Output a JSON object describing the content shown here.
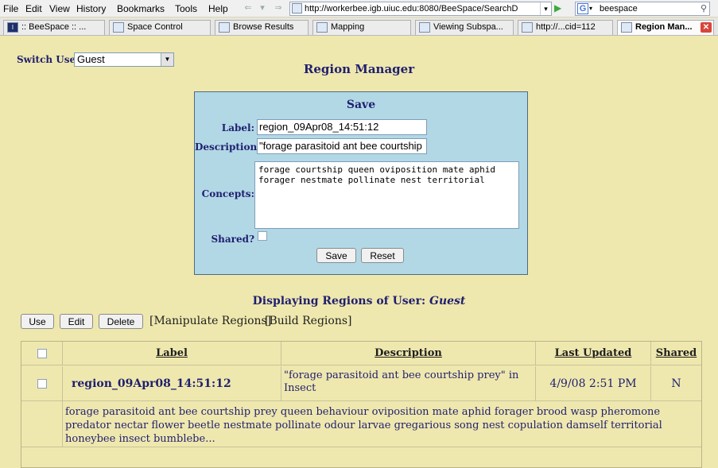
{
  "browser": {
    "menu": [
      "File",
      "Edit",
      "View",
      "History",
      "Bookmarks",
      "Tools",
      "Help"
    ],
    "url": "http://workerbee.igb.uiuc.edu:8080/BeeSpace/SearchD",
    "search_value": "beespace",
    "tabs": [
      {
        "label": ":: BeeSpace :: ..."
      },
      {
        "label": "Space Control"
      },
      {
        "label": "Browse Results"
      },
      {
        "label": "Mapping"
      },
      {
        "label": "Viewing Subspa..."
      },
      {
        "label": "http://...cid=112"
      },
      {
        "label": "Region Man..."
      }
    ]
  },
  "page": {
    "switch_user_label": "Switch User:",
    "user_selected": "Guest",
    "title": "Region Manager",
    "save": {
      "title": "Save",
      "label_label": "Label:",
      "label_value": "region_09Apr08_14:51:12",
      "description_label": "Description:",
      "description_value": "\"forage parasitoid ant bee courtship",
      "concepts_label": "Concepts:",
      "concepts_value": "forage courtship queen oviposition mate aphid forager nestmate pollinate nest territorial",
      "shared_label": "Shared?",
      "save_button": "Save",
      "reset_button": "Reset"
    },
    "regions_heading": "Displaying Regions of User:",
    "regions_user": "Guest",
    "actions": {
      "use": "Use",
      "edit": "Edit",
      "delete": "Delete",
      "manipulate": "[Manipulate Regions]",
      "build": "[Build Regions]"
    },
    "table": {
      "headers": {
        "label": "Label",
        "description": "Description",
        "last_updated": "Last Updated",
        "shared": "Shared"
      },
      "row": {
        "label": "region_09Apr08_14:51:12",
        "description": "\"forage parasitoid ant bee courtship prey\" in Insect",
        "last_updated": "4/9/08 2:51 PM",
        "shared": "N",
        "concepts": "forage parasitoid ant bee courtship prey queen behaviour oviposition mate aphid forager brood wasp pheromone predator nectar flower beetle nestmate pollinate odour larvae gregarious song nest copulation damself territorial honeybee insect bumblebe..."
      }
    }
  }
}
